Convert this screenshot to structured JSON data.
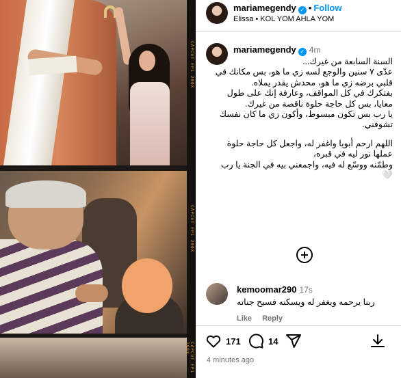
{
  "header": {
    "username": "mariamegendy",
    "follow_label": "Follow",
    "audio": "Elissa • KOL YOM AHLA YOM"
  },
  "caption": {
    "username": "mariamegendy",
    "time": "4m",
    "lines": [
      "السنة السابعة من غيرك...",
      "عدّى ٧ سنين والوجع لسه زي ما هو، بس مكانك في قلبي برضه زي ما هو، محدش يقدر يملاه.",
      "بفتكرك في كل المواقف، وعارفة إنك على طول معايا، بس كل حاجة حلوة ناقصة من غيرك.",
      "يا رب بس تكون مبسوط، وأكون زي ما كان نفسك تشوفني.",
      "اللهم ارحم أبويا واغفر له، واجعل كل حاجة حلوة عملها نور ليه في قبره،",
      "وطمّنه ووسّع له فيه، واجمعني بيه في الجنة يا رب🤍"
    ]
  },
  "comment": {
    "username": "kemoomar290",
    "time": "17s",
    "text": "ربنا يرحمه ويغفر له ويسكنه فسيح جناته",
    "like_label": "Like",
    "reply_label": "Reply"
  },
  "actions": {
    "likes": "171",
    "comments": "14",
    "timestamp": "4 minutes ago"
  },
  "film": {
    "edge_text_1": "CAPCUT FP1 200X",
    "edge_text_2": "CAPCUT FP1 200X",
    "edge_text_3": "CAPCUT FP1 200X"
  },
  "colors": {
    "accent": "#0095f6",
    "muted": "#737373",
    "divider": "#dbdbdb"
  },
  "icons": [
    "verified-badge-icon",
    "more-options-icon",
    "heart-icon",
    "comment-icon",
    "share-icon",
    "bookmark-icon",
    "download-icon"
  ]
}
